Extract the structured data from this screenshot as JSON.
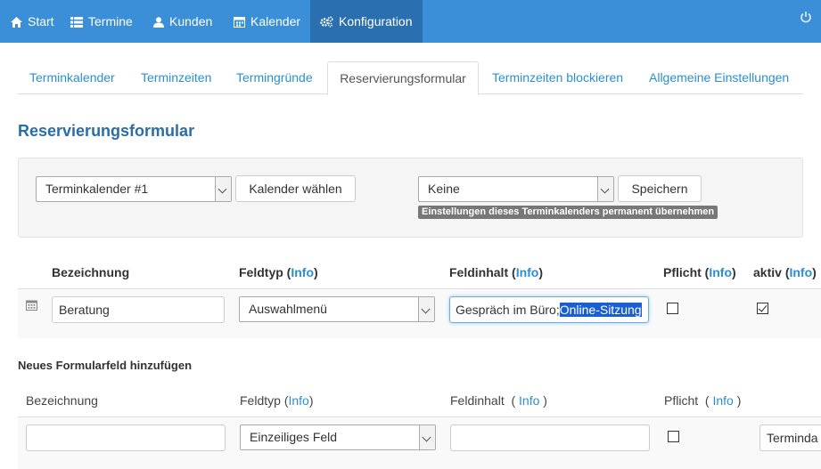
{
  "nav": {
    "items": [
      {
        "label": "Start",
        "icon": "home-icon"
      },
      {
        "label": "Termine",
        "icon": "list-icon"
      },
      {
        "label": "Kunden",
        "icon": "user-icon"
      },
      {
        "label": "Kalender",
        "icon": "calendar-icon"
      },
      {
        "label": "Konfiguration",
        "icon": "cogs-icon"
      }
    ],
    "active_index": 4,
    "power_icon": "power-icon"
  },
  "tabs": [
    {
      "label": "Terminkalender"
    },
    {
      "label": "Terminzeiten"
    },
    {
      "label": "Termingründe"
    },
    {
      "label": "Reservierungsformular"
    },
    {
      "label": "Terminzeiten blockieren"
    },
    {
      "label": "Allgemeine Einstellungen"
    }
  ],
  "page_title": "Reservierungsformular",
  "toolbar": {
    "calendar_select": "Terminkalender #1",
    "calendar_button": "Kalender wählen",
    "template_select": "Keine",
    "save_button": "Speichern",
    "hint": "Einstellungen dieses Terminkalenders permanent übernehmen"
  },
  "table": {
    "headers": {
      "name": "Bezeichnung",
      "type": "Feldtyp",
      "content": "Feldinhalt",
      "required": "Pflicht",
      "active": "aktiv",
      "info_open": "(",
      "info": "Info",
      "info_close": ")"
    },
    "rows": [
      {
        "name": "Beratung",
        "type": "Auswahlmenü",
        "content_plain": "Gespräch im Büro;",
        "content_selected": "Online-Sitzung",
        "required": false,
        "active": true
      }
    ]
  },
  "new_field": {
    "title": "Neues Formularfeld hinzufügen",
    "headers": {
      "name": "Bezeichnung",
      "type": "Feldtyp",
      "content": "Feldinhalt",
      "required": "Pflicht",
      "info_open": "(",
      "info": "Info",
      "info_close": ")"
    },
    "name_value": "",
    "type_value": "Einzeiliges Feld",
    "content_value": "",
    "required": false,
    "extra_select": "Terminda"
  },
  "colors": {
    "navbar": "#3a8fd8",
    "navbar_active": "#2a6fb0",
    "link": "#2a8fd0",
    "title": "#2a6ea6"
  }
}
